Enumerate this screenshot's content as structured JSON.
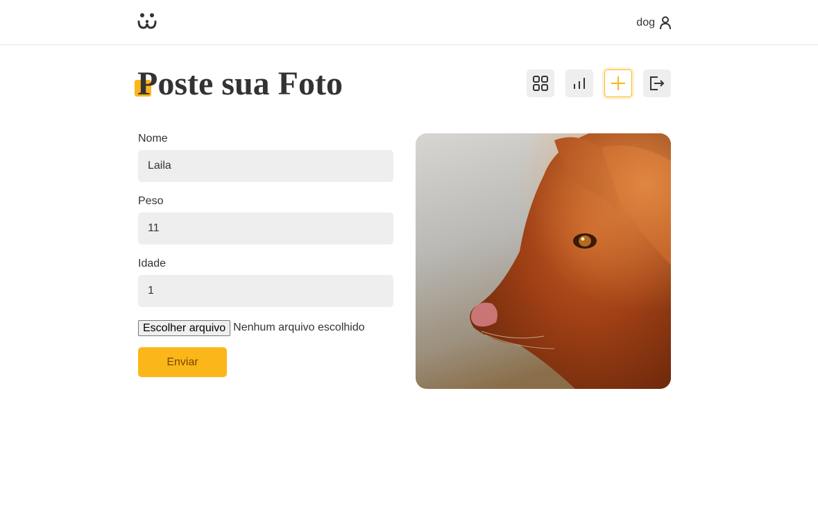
{
  "header": {
    "username": "dog",
    "logo_icon": "dog-face-logo-icon",
    "user_icon": "user-icon"
  },
  "page": {
    "title": "Poste sua Foto"
  },
  "nav": {
    "items": [
      {
        "name": "feed",
        "icon": "grid-icon",
        "active": false
      },
      {
        "name": "stats",
        "icon": "bar-chart-icon",
        "active": false
      },
      {
        "name": "post",
        "icon": "plus-icon",
        "active": true
      },
      {
        "name": "logout",
        "icon": "logout-icon",
        "active": false
      }
    ]
  },
  "form": {
    "nome": {
      "label": "Nome",
      "value": "Laila"
    },
    "peso": {
      "label": "Peso",
      "value": "11"
    },
    "idade": {
      "label": "Idade",
      "value": "1"
    },
    "file": {
      "button_label": "Escolher arquivo",
      "status": "Nenhum arquivo escolhido"
    },
    "submit_label": "Enviar"
  },
  "colors": {
    "accent": "#fbb719",
    "accent_text": "#764701",
    "input_bg": "#eeeeee",
    "text": "#333333"
  }
}
